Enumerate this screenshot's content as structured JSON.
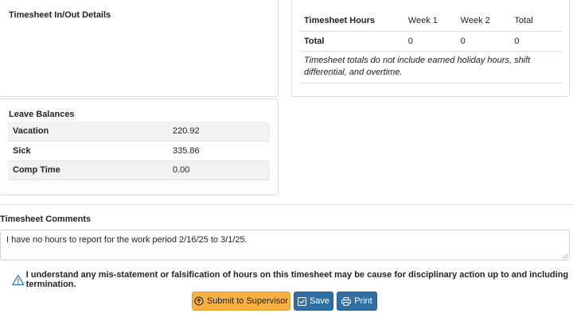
{
  "inout": {
    "title": "Timesheet In/Out Details"
  },
  "hours": {
    "headers": [
      "Timesheet Hours",
      "Week 1",
      "Week 2",
      "Total"
    ],
    "total_row": {
      "label": "Total",
      "week1": "0",
      "week2": "0",
      "total": "0"
    },
    "note": "Timesheet totals do not include earned holiday hours, shift differential, and overtime."
  },
  "leave": {
    "title": "Leave Balances",
    "rows": [
      {
        "label": "Vacation",
        "value": "220.92"
      },
      {
        "label": "Sick",
        "value": "335.86"
      },
      {
        "label": "Comp Time",
        "value": "0.00"
      }
    ]
  },
  "comments": {
    "label": "Timesheet Comments",
    "value": "I have no hours to report for the work period 2/16/25 to 3/1/25."
  },
  "warning": {
    "icon": "warning-triangle-icon",
    "text": "I understand any mis-statement or falsification of hours on this timesheet may be cause for disciplinary action up to and including termination."
  },
  "buttons": {
    "submit": "Submit to Supervisor",
    "save": "Save",
    "print": "Print"
  },
  "colors": {
    "submit": "#f9b043",
    "primary": "#2f6fa6",
    "warning_icon": "#2f6fa6"
  }
}
